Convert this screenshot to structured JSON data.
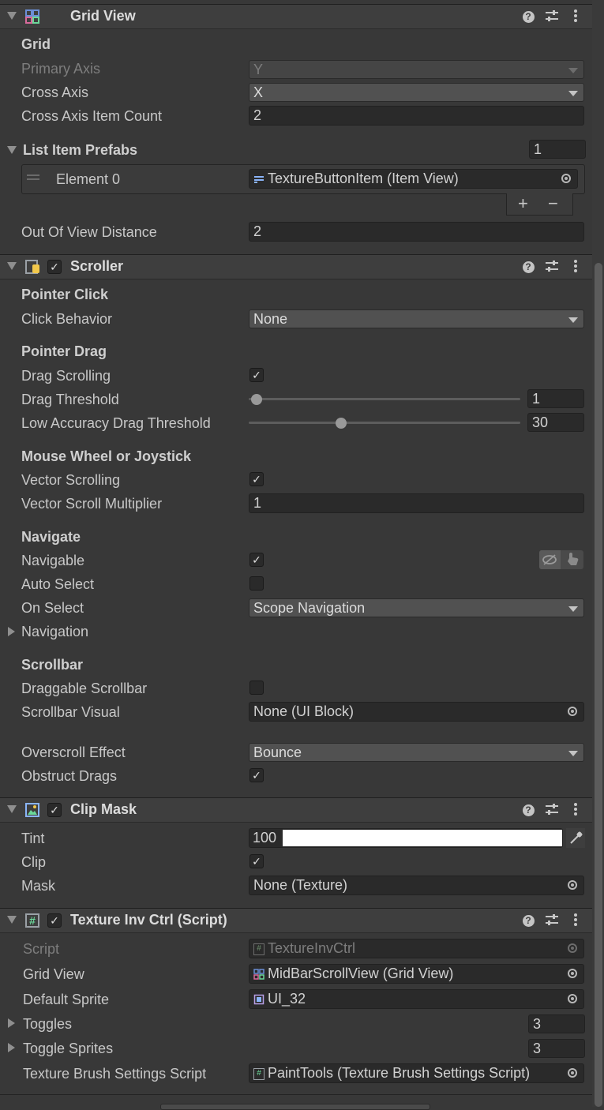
{
  "grid_view": {
    "title": "Grid View",
    "section": "Grid",
    "primary_axis_label": "Primary Axis",
    "primary_axis_value": "Y",
    "cross_axis_label": "Cross Axis",
    "cross_axis_value": "X",
    "cross_count_label": "Cross Axis Item Count",
    "cross_count_value": "2",
    "prefabs_label": "List Item Prefabs",
    "prefabs_count": "1",
    "element0_label": "Element 0",
    "element0_value": "TextureButtonItem (Item View)",
    "add_symbol": "+",
    "remove_symbol": "−",
    "out_of_view_label": "Out Of View Distance",
    "out_of_view_value": "2"
  },
  "scroller": {
    "title": "Scroller",
    "pointer_click_section": "Pointer Click",
    "click_behavior_label": "Click Behavior",
    "click_behavior_value": "None",
    "pointer_drag_section": "Pointer Drag",
    "drag_scrolling_label": "Drag Scrolling",
    "drag_threshold_label": "Drag Threshold",
    "drag_threshold_value": "1",
    "low_acc_label": "Low Accuracy Drag Threshold",
    "low_acc_value": "30",
    "wheel_section": "Mouse Wheel or Joystick",
    "vector_scrolling_label": "Vector Scrolling",
    "vector_mult_label": "Vector Scroll Multiplier",
    "vector_mult_value": "1",
    "navigate_section": "Navigate",
    "navigable_label": "Navigable",
    "auto_select_label": "Auto Select",
    "on_select_label": "On Select",
    "on_select_value": "Scope Navigation",
    "navigation_label": "Navigation",
    "scrollbar_section": "Scrollbar",
    "draggable_scrollbar_label": "Draggable Scrollbar",
    "scrollbar_visual_label": "Scrollbar Visual",
    "scrollbar_visual_value": "None (UI Block)",
    "overscroll_label": "Overscroll Effect",
    "overscroll_value": "Bounce",
    "obstruct_label": "Obstruct Drags"
  },
  "clip_mask": {
    "title": "Clip Mask",
    "tint_label": "Tint",
    "tint_value": "100",
    "clip_label": "Clip",
    "mask_label": "Mask",
    "mask_value": "None (Texture)"
  },
  "texture_inv": {
    "title": "Texture Inv Ctrl (Script)",
    "script_label": "Script",
    "script_value": "TextureInvCtrl",
    "grid_view_label": "Grid View",
    "grid_view_value": "MidBarScrollView (Grid View)",
    "default_sprite_label": "Default Sprite",
    "default_sprite_value": "UI_32",
    "toggles_label": "Toggles",
    "toggles_count": "3",
    "toggle_sprites_label": "Toggle Sprites",
    "toggle_sprites_count": "3",
    "brush_label": "Texture Brush Settings Script",
    "brush_value": "PaintTools (Texture Brush Settings Script)"
  },
  "states": {
    "drag_threshold_fraction": 0.03,
    "low_acc_fraction": 0.34,
    "drag_scrolling": true,
    "vector_scrolling": true,
    "navigable": true,
    "auto_select": false,
    "draggable_scrollbar": false,
    "obstruct_drags": true,
    "clip": true
  },
  "colors": {
    "background": "#383838",
    "field": "#2a2a2a",
    "header": "#3e3e3e",
    "tint": "#ffffff"
  }
}
